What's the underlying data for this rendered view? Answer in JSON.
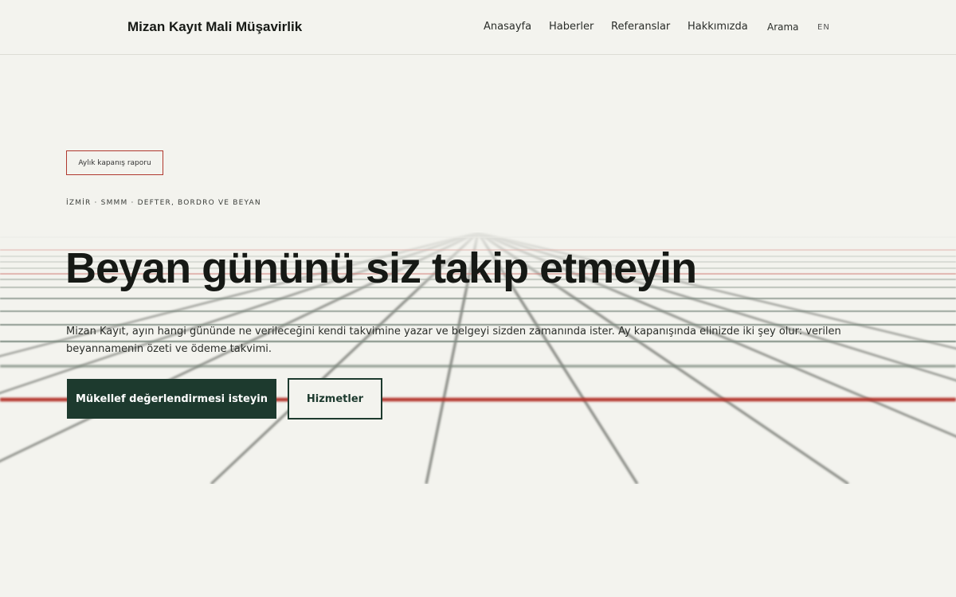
{
  "brand": "Mizan Kayıt Mali Müşavirlik",
  "nav": {
    "items": [
      "Anasayfa",
      "Haberler",
      "Referanslar",
      "Hakkımızda",
      "Arama"
    ],
    "lang": "EN"
  },
  "hero": {
    "chip": "Aylık kapanış raporu",
    "eyebrow": "İZMİR · SMMM · DEFTER, BORDRO VE BEYAN",
    "title": "Beyan gününü siz takip etmeyin",
    "lead": "Mizan Kayıt, ayın hangi gününde ne verileceğini kendi takvimine yazar ve belgeyi sizden zamanında ister. Ay kapanışında elinizde iki şey olur: verilen beyannamenin özeti ve ödeme takvimi.",
    "primary_cta": "Mükellef değerlendirmesi isteyin",
    "secondary_cta": "Hizmetler"
  },
  "colors": {
    "background": "#f3f3ee",
    "accent_green": "#1d3a2e",
    "accent_red": "#b0382e"
  }
}
